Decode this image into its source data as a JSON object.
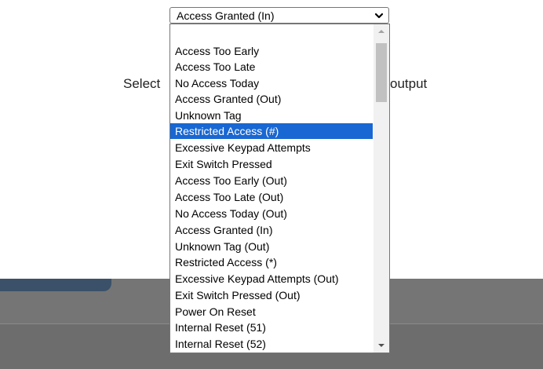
{
  "page": {
    "text_left": "Select",
    "text_right": "output"
  },
  "select": {
    "value": "Access Granted (In)",
    "arrow_icon": "chevron-down-icon"
  },
  "dropdown": {
    "selected_index": 5,
    "options": [
      "",
      "Access Too Early",
      "Access Too Late",
      "No Access Today",
      "Access Granted (Out)",
      "Unknown Tag",
      "Restricted Access (#)",
      "Excessive Keypad Attempts",
      "Exit Switch Pressed",
      "Access Too Early (Out)",
      "Access Too Late (Out)",
      "No Access Today (Out)",
      "Access Granted (In)",
      "Unknown Tag (Out)",
      "Restricted Access (*)",
      "Excessive Keypad Attempts (Out)",
      "Exit Switch Pressed (Out)",
      "Power On Reset",
      "Internal Reset (51)",
      "Internal Reset (52)"
    ],
    "highlight_option": "Restricted Access (#)",
    "scroll_position": 0.0
  },
  "colors": {
    "highlight": "#1967d2",
    "band": "#757575",
    "pill": "#3a5169"
  }
}
